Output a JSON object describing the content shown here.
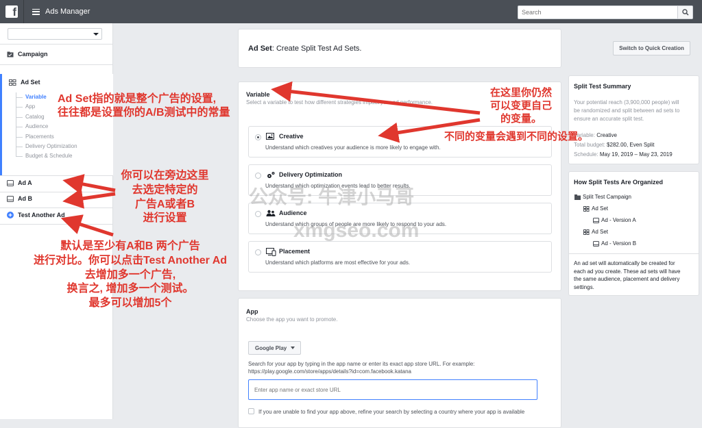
{
  "topbar": {
    "app_title": "Ads Manager",
    "search_placeholder": "Search",
    "logo_letter": "f"
  },
  "sidebar": {
    "campaign": "Campaign",
    "ad_set": "Ad Set",
    "tree": [
      "Variable",
      "App",
      "Catalog",
      "Audience",
      "Placements",
      "Delivery Optimization",
      "Budget & Schedule"
    ],
    "ad_a": "Ad A",
    "ad_b": "Ad B",
    "test_another": "Test Another Ad"
  },
  "header": {
    "title_bold": "Ad Set",
    "title_rest": ": Create Split Test Ad Sets.",
    "switch_button": "Switch to Quick Creation"
  },
  "variable": {
    "title": "Variable",
    "subtitle": "Select a variable to test how different strategies impact your ad performance.",
    "options": [
      {
        "name": "Creative",
        "desc": "Understand which creatives your audience is more likely to engage with.",
        "selected": true,
        "icon": "image-icon"
      },
      {
        "name": "Delivery Optimization",
        "desc": "Understand which optimization events lead to better results.",
        "selected": false,
        "icon": "gears-icon"
      },
      {
        "name": "Audience",
        "desc": "Understand which groups of people are more likely to respond to your ads.",
        "selected": false,
        "icon": "people-icon"
      },
      {
        "name": "Placement",
        "desc": "Understand which platforms are most effective for your ads.",
        "selected": false,
        "icon": "devices-icon"
      }
    ]
  },
  "app": {
    "title": "App",
    "subtitle": "Choose the app you want to promote.",
    "store_select": "Google Play",
    "help_line1": "Search for your app by typing in the app name or enter its exact app store URL. For example:",
    "help_line2": "https://play.google.com/store/apps/details?id=com.facebook.katana",
    "input_placeholder": "Enter app name or exact store URL",
    "checkbox_label": "If you are unable to find your app above, refine your search by selecting a country where your app is available"
  },
  "summary": {
    "title": "Split Test Summary",
    "reach_lines": [
      "Your potential reach (3,900,000 people) will",
      "be randomized and split between ad sets to",
      "ensure an accurate split test."
    ],
    "variable_label": "Variable:",
    "variable_value": "Creative",
    "budget_label": "Total budget:",
    "budget_value": "$282.00, Even Split",
    "schedule_label": "Schedule:",
    "schedule_value": "May 19, 2019 – May 23, 2019"
  },
  "organized": {
    "title": "How Split Tests Are Organized",
    "rows": [
      "Split Test Campaign",
      "Ad Set",
      "Ad - Version A",
      "Ad Set",
      "Ad - Version B"
    ],
    "note_lines": [
      "An ad set will automatically be created for",
      "each ad you create. These ad sets will have",
      "the same audience, placement and delivery",
      "settings."
    ]
  },
  "annotations": {
    "adset_line1": "Ad Set指的就是整个广告的设置,",
    "adset_line2": "往往都是设置你的A/B测试中的常量",
    "var_line1": "在这里你仍然",
    "var_line2": "可以变更自己",
    "var_line3": "的变量。",
    "var_line4": "不同的变量会遇到不同的设置。",
    "side_line1": "你可以在旁边这里",
    "side_line2": "去选定特定的",
    "side_line3": "广告A或者B",
    "side_line4": "进行设置",
    "bottom_line1": "默认是至少有A和B 两个广告",
    "bottom_line2": "进行对比。你可以点击Test Another Ad",
    "bottom_line3": "去增加多一个广告,",
    "bottom_line4": "换言之, 增加多一个测试。",
    "bottom_line5": "最多可以增加5个",
    "watermark1": "公众号: 牛津小马哥",
    "watermark2": "xmgseo.com"
  },
  "colors": {
    "topbar": "#4a4f56",
    "accent": "#4080ff",
    "annotation": "#e0372e"
  }
}
